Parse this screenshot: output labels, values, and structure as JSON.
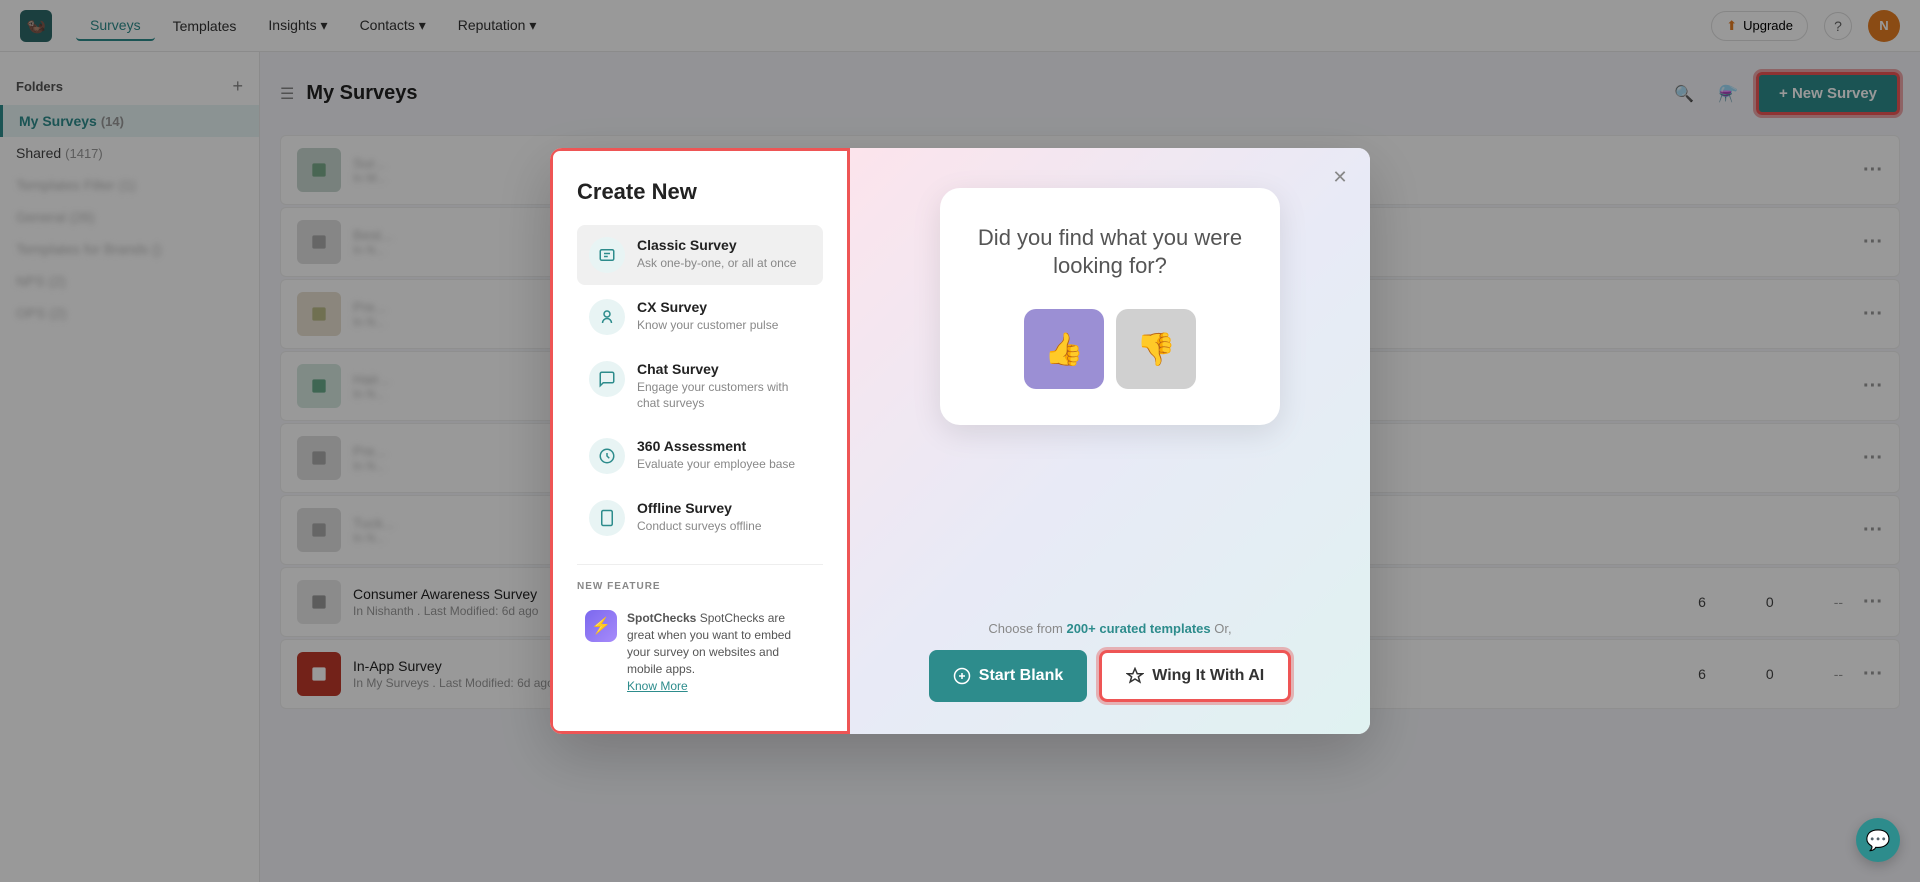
{
  "nav": {
    "logo": "🦦",
    "links": [
      {
        "label": "Surveys",
        "active": true
      },
      {
        "label": "Templates",
        "active": false
      },
      {
        "label": "Insights ▾",
        "active": false
      },
      {
        "label": "Contacts ▾",
        "active": false
      },
      {
        "label": "Reputation ▾",
        "active": false
      }
    ],
    "upgrade": "Upgrade",
    "help": "?",
    "user_initials": "N"
  },
  "sidebar": {
    "folders_label": "Folders",
    "items": [
      {
        "label": "My Surveys",
        "count": "(14)",
        "active": true
      },
      {
        "label": "Shared",
        "count": "(1417)",
        "active": false
      }
    ],
    "blurred_items": [
      "Templates Filter (1)",
      "General (26)",
      "Templates for Brands ()",
      "NPS (2)",
      "OPS (2)"
    ]
  },
  "main": {
    "title": "My Surveys",
    "new_survey_label": "+ New Survey"
  },
  "surveys": [
    {
      "name": "Sur...",
      "meta": "In M...",
      "blurred": true,
      "responses": "",
      "completions": "",
      "dash": "—"
    },
    {
      "name": "Best...",
      "meta": "In N...",
      "blurred": true,
      "responses": "",
      "completions": "",
      "dash": "—"
    },
    {
      "name": "Pre...",
      "meta": "In N...",
      "blurred": true,
      "responses": "",
      "completions": "",
      "dash": "—"
    },
    {
      "name": "Hair...",
      "meta": "In N...",
      "blurred": true,
      "responses": "",
      "completions": "",
      "dash": "—"
    },
    {
      "name": "Pre...",
      "meta": "In N...",
      "blurred": true,
      "responses": "",
      "completions": "",
      "dash": "—"
    },
    {
      "name": "Tuck...",
      "meta": "In N...",
      "blurred": true,
      "responses": "",
      "completions": "",
      "dash": "—"
    },
    {
      "name": "Consumer Awareness Survey",
      "meta": "In Nishanth . Last Modified: 6d ago",
      "blurred": false,
      "responses": "6",
      "completions": "0",
      "dash": "--"
    },
    {
      "name": "In-App Survey",
      "meta": "In My Surveys . Last Modified: 6d ago",
      "blurred": false,
      "responses": "6",
      "completions": "0",
      "dash": "--"
    }
  ],
  "modal": {
    "title": "Create New",
    "options": [
      {
        "title": "Classic Survey",
        "desc": "Ask one-by-one, or all at once",
        "icon": "classic"
      },
      {
        "title": "CX Survey",
        "desc": "Know your customer pulse",
        "icon": "cx"
      },
      {
        "title": "Chat Survey",
        "desc": "Engage your customers with chat surveys",
        "icon": "chat"
      },
      {
        "title": "360 Assessment",
        "desc": "Evaluate your employee base",
        "icon": "360"
      },
      {
        "title": "Offline Survey",
        "desc": "Conduct surveys offline",
        "icon": "offline"
      }
    ],
    "new_feature_label": "NEW FEATURE",
    "spotchecks_text": "SpotChecks are great when you want to embed your survey on websites and mobile apps.",
    "spotchecks_link": "Know More",
    "preview_question": "Did you find what you were looking for?",
    "bottom_text_before": "Choose from ",
    "bottom_text_highlight": "200+ curated templates",
    "bottom_text_after": " Or,",
    "start_blank_label": "Start Blank",
    "wing_ai_label": "Wing It With AI"
  }
}
